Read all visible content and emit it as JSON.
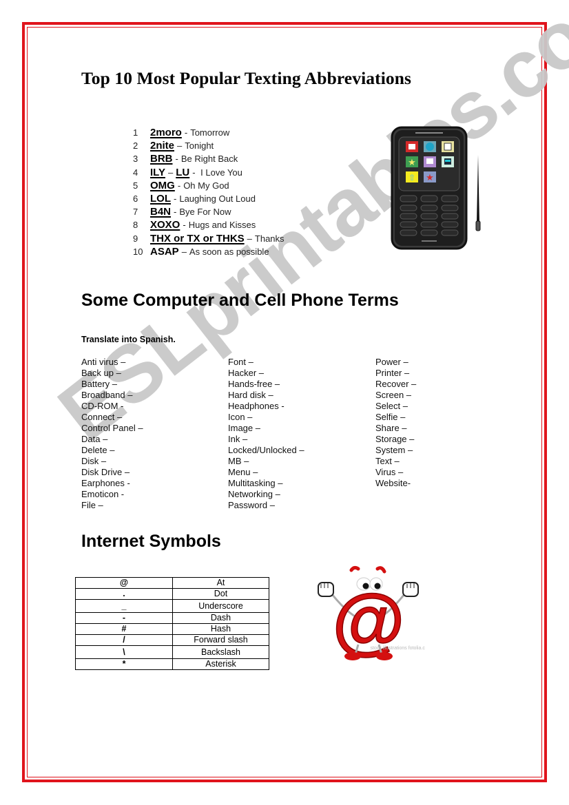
{
  "watermark": "ESLprintables.com",
  "colors": {
    "border_red": "#e0141c",
    "watermark_gray": "#c9c9c9"
  },
  "section1": {
    "title": "Top 10 Most Popular Texting Abbreviations",
    "items": [
      {
        "num": "1",
        "codes": [
          "2moro"
        ],
        "sep": "-",
        "meaning": "Tomorrow",
        "underlined": true
      },
      {
        "num": "2",
        "codes": [
          "2nite"
        ],
        "sep": "–",
        "meaning": "Tonight",
        "underlined": true
      },
      {
        "num": "3",
        "codes": [
          "BRB"
        ],
        "sep": "-",
        "meaning": "Be Right Back",
        "underlined": true
      },
      {
        "num": "4",
        "codes": [
          "ILY",
          "LU"
        ],
        "joiner": "–",
        "sep": "-",
        "meaning": " I Love You",
        "underlined": true
      },
      {
        "num": "5",
        "codes": [
          "OMG"
        ],
        "sep": "-",
        "meaning": "Oh My God",
        "underlined": true
      },
      {
        "num": "6",
        "codes": [
          "LOL"
        ],
        "sep": "-",
        "meaning": "Laughing Out Loud",
        "underlined": true
      },
      {
        "num": "7",
        "codes": [
          "B4N"
        ],
        "sep": "-",
        "meaning": "Bye For Now",
        "underlined": true
      },
      {
        "num": "8",
        "codes": [
          "XOXO"
        ],
        "sep": "-",
        "meaning": "Hugs and Kisses",
        "underlined": true
      },
      {
        "num": "9",
        "codes": [
          "THX or TX or THKS"
        ],
        "sep": "–",
        "meaning": "Thanks",
        "underlined": true
      },
      {
        "num": "10",
        "codes": [
          "ASAP"
        ],
        "sep": "–",
        "meaning": "As soon as possible",
        "underlined": false
      }
    ],
    "image": "cell-phone-with-stylus"
  },
  "section2": {
    "title": "Some Computer and Cell Phone Terms",
    "instruction": "Translate into Spanish.",
    "columns": [
      [
        "Anti virus –",
        "Back up –",
        "Battery –",
        "Broadband –",
        "CD-ROM -",
        "Connect –",
        "Control Panel –",
        "Data –",
        "Delete –",
        "Disk –",
        "Disk Drive –",
        "Earphones -",
        "Emoticon -",
        "File –"
      ],
      [
        "Font –",
        "Hacker –",
        "Hands-free –",
        "Hard disk –",
        "Headphones -",
        "Icon –",
        "Image –",
        "Ink –",
        "Locked/Unlocked –",
        "MB –",
        "Menu –",
        "Multitasking –",
        "Networking –",
        "Password –"
      ],
      [
        "Power –",
        "Printer –",
        "Recover –",
        "Screen –",
        "Select –",
        "Selfie –",
        "Share –",
        "Storage –",
        "System –",
        "Text –",
        "Virus –",
        "Website-"
      ]
    ]
  },
  "section3": {
    "title": "Internet Symbols",
    "rows": [
      {
        "symbol": "@",
        "name": "At"
      },
      {
        "symbol": ".",
        "name": "Dot"
      },
      {
        "symbol": "_",
        "name": "Underscore"
      },
      {
        "symbol": "-",
        "name": "Dash"
      },
      {
        "symbol": "#",
        "name": "Hash"
      },
      {
        "symbol": "/",
        "name": "Forward slash"
      },
      {
        "symbol": "\\",
        "name": "Backslash"
      },
      {
        "symbol": "*",
        "name": "Asterisk"
      }
    ],
    "image": "at-sign-mascot",
    "image_credit": "stock illustrations fotolia.com"
  }
}
